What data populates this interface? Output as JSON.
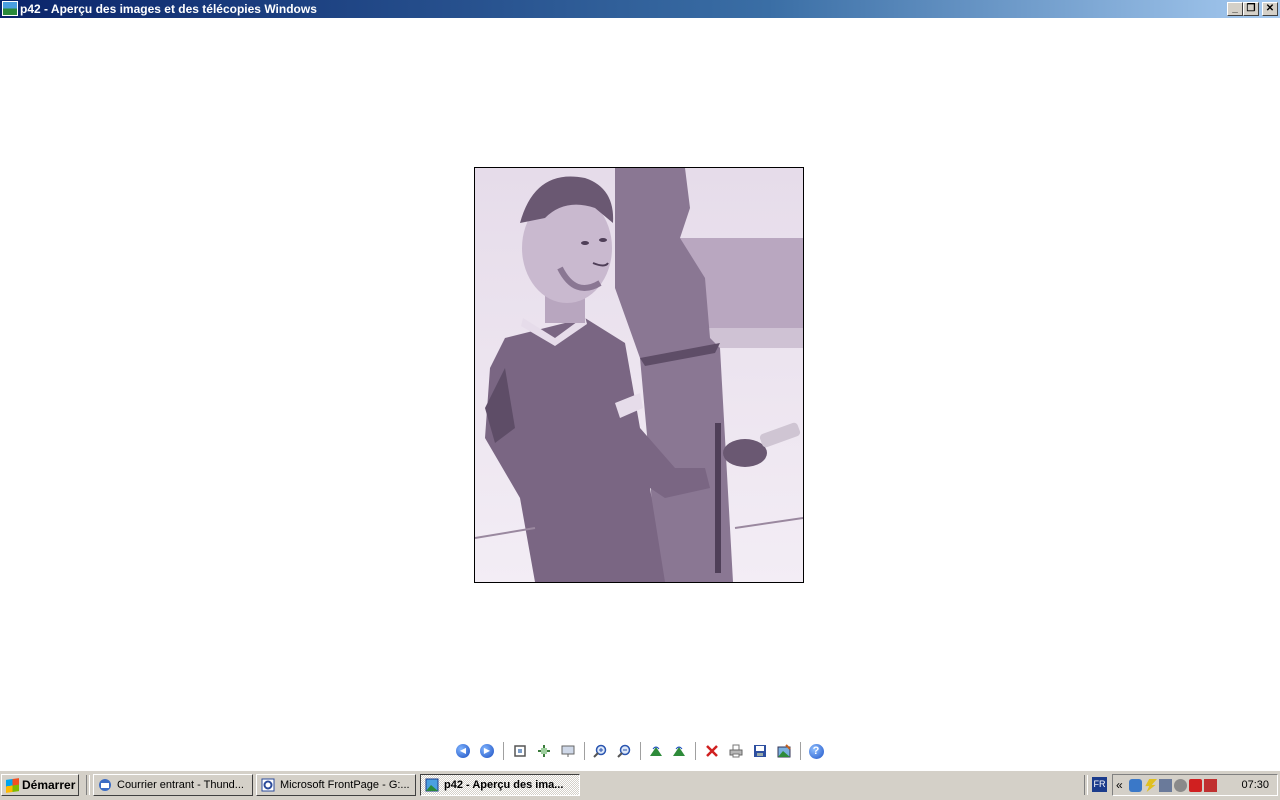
{
  "window": {
    "title": "p42 - Aperçu des images et des télécopies Windows",
    "controls": {
      "minimize": "_",
      "restore": "❐",
      "close": "✕"
    }
  },
  "toolbar": {
    "buttons": [
      {
        "name": "previous-image",
        "icon": "prev-circle-icon",
        "glyph": "◀"
      },
      {
        "name": "next-image",
        "icon": "next-circle-icon",
        "glyph": "▶"
      },
      {
        "name": "best-fit",
        "icon": "best-fit-icon"
      },
      {
        "name": "actual-size",
        "icon": "actual-size-icon"
      },
      {
        "name": "slideshow",
        "icon": "slideshow-icon"
      },
      {
        "name": "zoom-in",
        "icon": "zoom-in-icon"
      },
      {
        "name": "zoom-out",
        "icon": "zoom-out-icon"
      },
      {
        "name": "rotate-clockwise",
        "icon": "rotate-cw-icon"
      },
      {
        "name": "rotate-counterclockwise",
        "icon": "rotate-ccw-icon"
      },
      {
        "name": "delete",
        "icon": "delete-icon"
      },
      {
        "name": "print",
        "icon": "print-icon"
      },
      {
        "name": "save-copy",
        "icon": "save-icon"
      },
      {
        "name": "open-for-editing",
        "icon": "edit-image-icon"
      },
      {
        "name": "help",
        "icon": "help-icon",
        "glyph": "?"
      }
    ]
  },
  "taskbar": {
    "start_label": "Démarrer",
    "tasks": [
      {
        "label": "Courrier entrant - Thund...",
        "icon": "thunderbird-icon",
        "active": false
      },
      {
        "label": "Microsoft FrontPage - G:...",
        "icon": "frontpage-icon",
        "active": false
      },
      {
        "label": "p42 - Aperçu des ima...",
        "icon": "image-viewer-icon",
        "active": true
      }
    ],
    "language": "FR",
    "tray_expand": "«",
    "clock": "07:30"
  },
  "colors": {
    "titlebar_start": "#0a246a",
    "titlebar_end": "#a6caf0",
    "taskbar": "#d4d0c8",
    "photo_tint": "#efe7f3"
  }
}
